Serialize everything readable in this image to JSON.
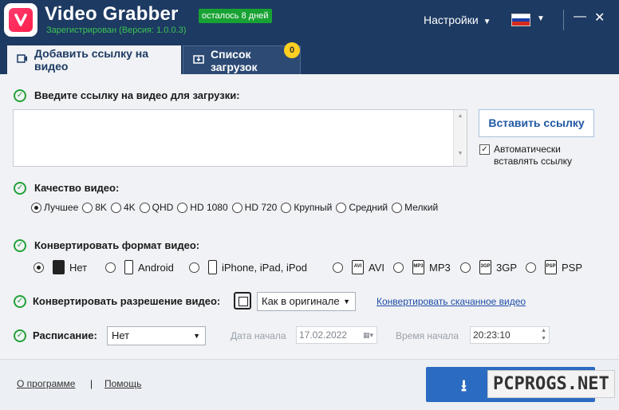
{
  "app": {
    "title": "Video Grabber",
    "days_left": "осталось 8 дней",
    "registered": "Зарегистрирован (Версия: 1.0.0.3)",
    "settings_label": "Настройки",
    "minimize": "—",
    "close": "✕"
  },
  "tabs": {
    "add_link": "Добавить ссылку на видео",
    "downloads": "Список загрузок",
    "downloads_count": "0"
  },
  "url_section": {
    "label": "Введите ссылку на видео для загрузки:",
    "value": "",
    "paste_button": "Вставить ссылку",
    "auto_paste_line1": "Автоматически",
    "auto_paste_line2": "вставлять ссылку",
    "auto_paste_checked": true
  },
  "quality": {
    "label": "Качество видео:",
    "options": [
      "Лучшее",
      "8K",
      "4K",
      "QHD",
      "HD 1080",
      "HD 720",
      "Крупный",
      "Средний",
      "Мелкий"
    ],
    "selected": "Лучшее"
  },
  "convert_format": {
    "label": "Конвертировать формат видео:",
    "options": [
      "Нет",
      "Android",
      "iPhone, iPad, iPod",
      "AVI",
      "MP3",
      "3GP",
      "PSP"
    ],
    "icon_labels": [
      "",
      "",
      "",
      "AVI",
      "MP3",
      "3GP",
      "PSP"
    ],
    "selected": "Нет"
  },
  "convert_resolution": {
    "label": "Конвертировать разрешение видео:",
    "value": "Как в оригинале",
    "link": "Конвертировать скачанное видео"
  },
  "schedule": {
    "label": "Расписание:",
    "value": "Нет",
    "start_date_label": "Дата начала",
    "start_date": "17.02.2022",
    "start_time_label": "Время начала",
    "start_time": "20:23:10"
  },
  "footer": {
    "about": "О программе",
    "separator": "|",
    "help": "Помощь",
    "download_icon": "⭳",
    "watermark": "PCPROGS.NET"
  }
}
